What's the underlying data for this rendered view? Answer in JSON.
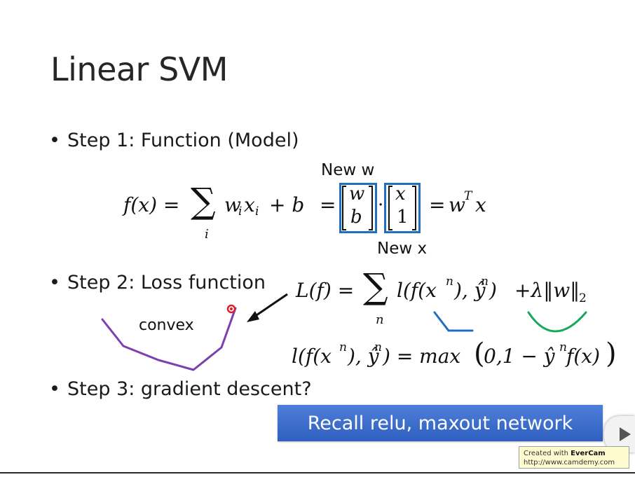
{
  "title": "Linear SVM",
  "step1": {
    "bullet": "•",
    "text": "Step 1: Function (Model)"
  },
  "step2": {
    "bullet": "•",
    "text": "Step 2: Loss function"
  },
  "step3": {
    "bullet": "•",
    "text": "Step 3: gradient descent?"
  },
  "annot": {
    "new_w": "New w",
    "new_x": "New x",
    "convex": "convex"
  },
  "eq1": {
    "fx": "f(x) =",
    "sigma": "∑",
    "sub_i": "i",
    "wx": "w",
    "wx_i": "i",
    "x": "x",
    "x_i": "i",
    "plus_b": "+ b",
    "eq": "=",
    "mat_w_top": "w",
    "mat_w_bot": "b",
    "dot": "·",
    "mat_x_top": "x",
    "mat_x_bot": "1",
    "eq2": "=",
    "wtx_w": "w",
    "wtx_T": "T",
    "wtx_x": "x"
  },
  "eq2": {
    "lf": "L(f) =",
    "sigma": "∑",
    "sub_n": "n",
    "term": "l(f(x",
    "sup_n1": "n",
    "mid": "), ŷ",
    "sup_n2": "n",
    "close": ")",
    "reg": "+λ‖w‖",
    "reg_sub": "2"
  },
  "eq3": {
    "lhs_a": "l(f(x",
    "sup1": "n",
    "lhs_b": "), ŷ",
    "sup2": "n",
    "lhs_c": ") = max",
    "open": "(",
    "inner_a": "0,1 − ŷ",
    "sup3": "n",
    "inner_b": "f(x)",
    "close": ")"
  },
  "banner": {
    "text": "Recall relu, maxout network"
  },
  "evercam": {
    "line1_a": "Created with ",
    "line1_b": "EverCam",
    "line2": "http://www.camdemy.com"
  },
  "colors": {
    "accent_blue": "#1f6fbf",
    "banner": "#3a67c8",
    "purple": "#7b3fb0",
    "green": "#1aa85a",
    "pointer_red": "#e0202a"
  }
}
